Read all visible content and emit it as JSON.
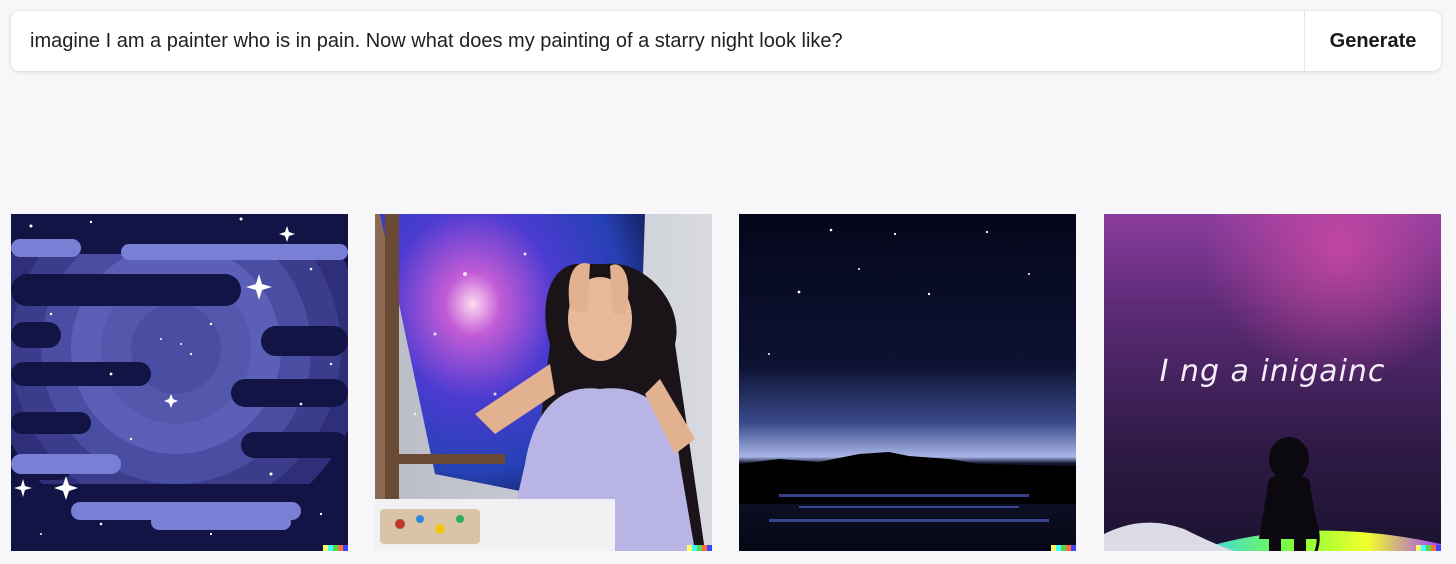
{
  "prompt": {
    "value": "imagine I am a painter who is in pain. Now what does my painting of a starry night look like?",
    "generate_label": "Generate"
  },
  "results": {
    "image_4_painted_text": "I ng a inigainc"
  },
  "colors": {
    "background": "#f7f7f9",
    "watermark": [
      "#ffff66",
      "#42ffff",
      "#51da4c",
      "#ff6e3c",
      "#3c46ff"
    ]
  }
}
